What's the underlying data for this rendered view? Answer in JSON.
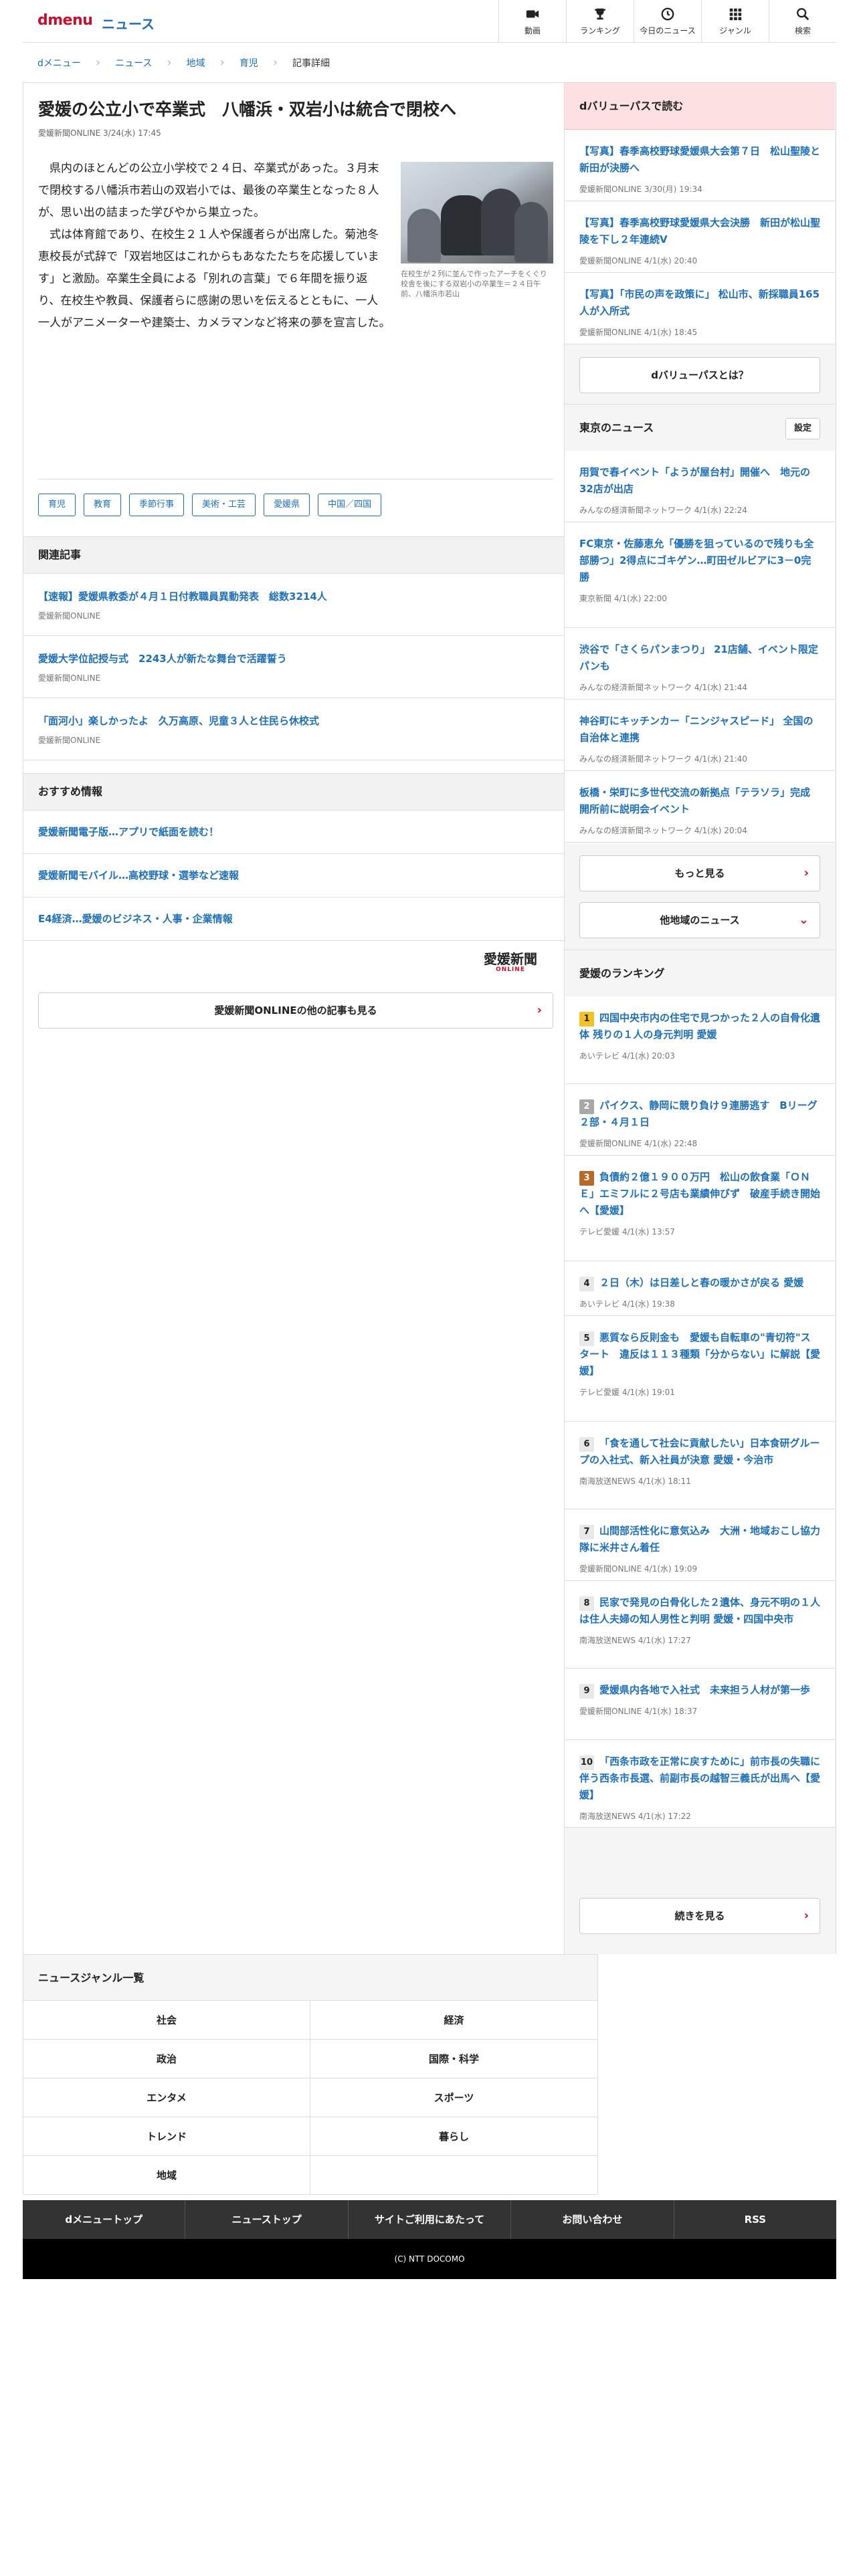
{
  "header": {
    "logo": "dmenu",
    "section": "ニュース",
    "nav": [
      {
        "label": "動画",
        "icon": "video-icon"
      },
      {
        "label": "ランキング",
        "icon": "trophy-icon"
      },
      {
        "label": "今日のニュース",
        "icon": "clock-icon"
      },
      {
        "label": "ジャンル",
        "icon": "grid-icon"
      },
      {
        "label": "検索",
        "icon": "search-icon"
      }
    ]
  },
  "breadcrumb": [
    "dメニュー",
    "ニュース",
    "地域",
    "育児",
    "記事詳細"
  ],
  "article": {
    "title": "愛媛の公立小で卒業式　八幡浜・双岩小は統合で閉校へ",
    "meta": "愛媛新聞ONLINE 3/24(水) 17:45",
    "paragraphs": [
      "県内のほとんどの公立小学校で２４日、卒業式があった。３月末で閉校する八幡浜市若山の双岩小では、最後の卒業生となった８人が、思い出の詰まった学びやから巣立った。",
      "式は体育館であり、在校生２１人や保護者らが出席した。菊池冬恵校長が式辞で「双岩地区はこれからもあなたたちを応援しています」と激励。卒業生全員による「別れの言葉」で６年間を振り返り、在校生や教員、保護者らに感謝の思いを伝えるとともに、一人一人がアニメーターや建築士、カメラマンなど将来の夢を宣言した。"
    ],
    "photo_caption": "在校生が２列に並んで作ったアーチをくぐり校舎を後にする双岩小の卒業生＝２４日午前、八幡浜市若山",
    "tags": [
      "育児",
      "教育",
      "季節行事",
      "美術・工芸",
      "愛媛県",
      "中国／四国"
    ]
  },
  "related": {
    "heading": "関連記事",
    "items": [
      {
        "title": "【速報】愛媛県教委が４月１日付教職員異動発表　総数3214人",
        "source": "愛媛新聞ONLINE"
      },
      {
        "title": "愛媛大学位記授与式　2243人が新たな舞台で活躍誓う",
        "source": "愛媛新聞ONLINE"
      },
      {
        "title": "「面河小」楽しかったよ　久万高原、児童３人と住民ら休校式",
        "source": "愛媛新聞ONLINE"
      }
    ]
  },
  "recommend": {
    "heading": "おすすめ情報",
    "items": [
      "愛媛新聞電子版…アプリで紙面を読む！",
      "愛媛新聞モバイル…高校野球・選挙など速報",
      "E4経済…愛媛のビジネス・人事・企業情報"
    ]
  },
  "publisher_logo": {
    "name": "愛媛新聞",
    "sub": "ONLINE"
  },
  "more_articles_label": "愛媛新聞ONLINEの他の記事も見る",
  "dvalue": {
    "heading": "dバリューパスで読む",
    "items": [
      {
        "title": "【写真】春季高校野球愛媛県大会第７日　松山聖陵と新田が決勝へ",
        "source": "愛媛新聞ONLINE 3/30(月) 19:34"
      },
      {
        "title": "【写真】春季高校野球愛媛県大会決勝　新田が松山聖陵を下し２年連続V",
        "source": "愛媛新聞ONLINE 4/1(水) 20:40"
      },
      {
        "title": "【写真】「市民の声を政策に」 松山市、新採職員165人が入所式",
        "source": "愛媛新聞ONLINE 4/1(水) 18:45"
      }
    ],
    "about_label": "dバリューパスとは？"
  },
  "tokyo": {
    "heading": "東京のニュース",
    "settings_label": "設定",
    "items": [
      {
        "title": "用賀で春イベント「ようが屋台村」開催へ　地元の32店が出店",
        "source": "みんなの経済新聞ネットワーク 4/1(水) 22:24"
      },
      {
        "title": "FC東京・佐藤恵允「優勝を狙っているので残りも全部勝つ」2得点にゴキゲン…町田ゼルビアに3－0完勝",
        "source": "東京新聞 4/1(水) 22:00"
      },
      {
        "title": "渋谷で「さくらパンまつり」 21店舗、イベント限定パンも",
        "source": "みんなの経済新聞ネットワーク 4/1(水) 21:44"
      },
      {
        "title": "神谷町にキッチンカー「ニンジャスピード」 全国の自治体と連携",
        "source": "みんなの経済新聞ネットワーク 4/1(水) 21:40"
      },
      {
        "title": "板橋・栄町に多世代交流の新拠点「テラソラ」完成　開所前に説明会イベント",
        "source": "みんなの経済新聞ネットワーク 4/1(水) 20:04"
      }
    ],
    "more_label": "もっと見る",
    "other_region_label": "他地域のニュース"
  },
  "ranking": {
    "heading": "愛媛のランキング",
    "items": [
      {
        "rank": "1",
        "title": "四国中央市内の住宅で見つかった２人の自骨化遺体 残りの１人の身元判明 愛媛",
        "source": "あいテレビ 4/1(水) 20:03"
      },
      {
        "rank": "2",
        "title": "パイクス、静岡に競り負け９連勝逃す　Bリーグ２部・４月１日",
        "source": "愛媛新聞ONLINE 4/1(水) 22:48"
      },
      {
        "rank": "3",
        "title": "負債約２億１９００万円　松山の飲食業「ＯＮＥ」エミフルに２号店も業績伸びず　破産手続き開始へ【愛媛】",
        "source": "テレビ愛媛 4/1(水) 13:57"
      },
      {
        "rank": "4",
        "title": "２日（木）は日差しと春の暖かさが戻る 愛媛",
        "source": "あいテレビ 4/1(水) 19:38"
      },
      {
        "rank": "5",
        "title": "悪質なら反則金も　愛媛も自転車の\"青切符\"スタート　違反は１１３種類「分からない」に解説【愛媛】",
        "source": "テレビ愛媛 4/1(水) 19:01"
      },
      {
        "rank": "6",
        "title": "「食を通して社会に貢献したい」日本食研グループの入社式、新入社員が決意 愛媛・今治市",
        "source": "南海放送NEWS 4/1(水) 18:11"
      },
      {
        "rank": "7",
        "title": "山間部活性化に意気込み　大洲・地域おこし協力隊に米井さん着任",
        "source": "愛媛新聞ONLINE 4/1(水) 19:09"
      },
      {
        "rank": "8",
        "title": "民家で発見の白骨化した２遺体、身元不明の１人は住人夫婦の知人男性と判明 愛媛・四国中央市",
        "source": "南海放送NEWS 4/1(水) 17:27"
      },
      {
        "rank": "9",
        "title": "愛媛県内各地で入社式　未来担う人材が第一歩",
        "source": "愛媛新聞ONLINE 4/1(水) 18:37"
      },
      {
        "rank": "10",
        "title": "「西条市政を正常に戻すために」前市長の失職に伴う西条市長選、前副市長の越智三義氏が出馬へ【愛媛】",
        "source": "南海放送NEWS 4/1(水) 17:22"
      }
    ],
    "more_label": "続きを見る"
  },
  "genre": {
    "heading": "ニュースジャンル一覧",
    "items": [
      "社会",
      "経済",
      "政治",
      "国際・科学",
      "エンタメ",
      "スポーツ",
      "トレンド",
      "暮らし",
      "地域",
      ""
    ]
  },
  "footer": {
    "nav": [
      "dメニュートップ",
      "ニューストップ",
      "サイトご利用にあたって",
      "お問い合わせ",
      "RSS"
    ],
    "copyright": "(C) NTT DOCOMO"
  },
  "colors": {
    "accent_blue": "#1d6fb8",
    "brand_red": "#c8102e",
    "dvalue_bg": "#fde0e1"
  }
}
